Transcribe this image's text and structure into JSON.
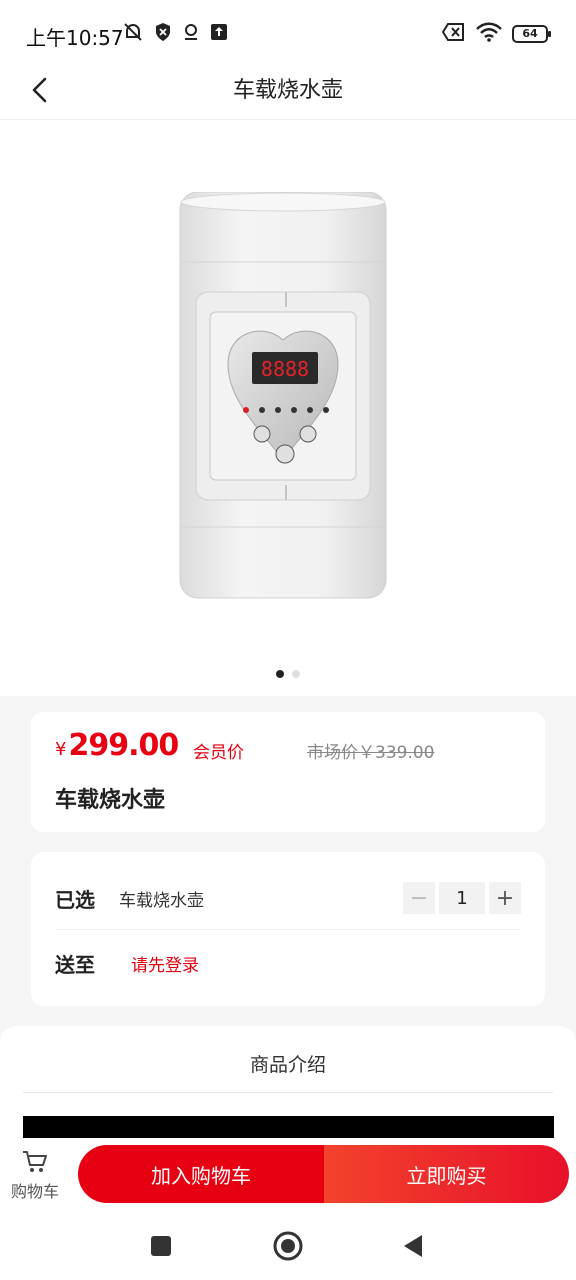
{
  "status_bar": {
    "time": "上午10:57",
    "battery": "64",
    "icons": [
      "mute-bell-icon",
      "shield-icon",
      "location-icon",
      "upload-icon",
      "sim-x-icon",
      "wifi-icon",
      "battery-icon"
    ]
  },
  "header": {
    "title": "车载烧水壶",
    "back_icon": "chevron-left-icon"
  },
  "gallery": {
    "image_alt": "车载烧水壶",
    "dots_total": 2,
    "dots_active": 1
  },
  "price_card": {
    "currency": "¥",
    "price": "299.00",
    "member_label": "会员价",
    "market_price": "市场价￥339.00",
    "product_name": "车载烧水壶"
  },
  "options": {
    "selected_label": "已选",
    "selected_value": "车载烧水壶",
    "quantity": "1",
    "minus": "−",
    "plus": "+",
    "ship_label": "送至",
    "ship_value": "请先登录"
  },
  "intro": {
    "title": "商品介绍"
  },
  "bottom_bar": {
    "cart_label": "购物车",
    "add_to_cart": "加入购物车",
    "buy_now": "立即购买"
  },
  "colors": {
    "accent": "#e60012",
    "accent_gradient_start": "#f2432c"
  }
}
